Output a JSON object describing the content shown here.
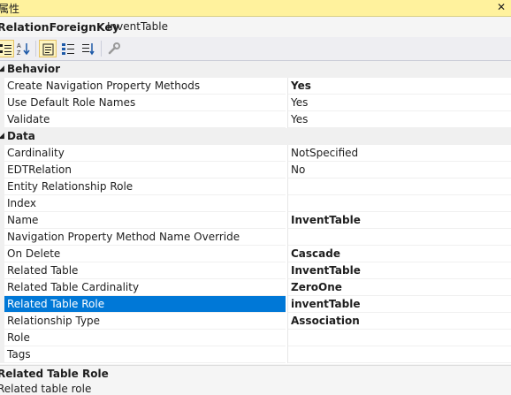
{
  "window": {
    "title": "属性",
    "close_glyph": "✕"
  },
  "object": {
    "name": "RelationForeignKey",
    "type": "InventTable"
  },
  "toolbar": {
    "buttons": [
      {
        "icon": "categorized-icon",
        "active": true
      },
      {
        "icon": "alphabetical-icon",
        "active": false
      },
      {
        "icon": "properties-icon",
        "active": true
      },
      {
        "icon": "events-icon",
        "active": false
      },
      {
        "icon": "sort-icon",
        "active": false
      },
      {
        "icon": "wrench-icon",
        "active": false
      }
    ]
  },
  "grid": {
    "categories": [
      {
        "label": "Behavior",
        "expander": "◢",
        "rows": [
          {
            "name": "Create Navigation Property Methods",
            "value": "Yes",
            "bold": true
          },
          {
            "name": "Use Default Role Names",
            "value": "Yes",
            "bold": false
          },
          {
            "name": "Validate",
            "value": "Yes",
            "bold": false
          }
        ]
      },
      {
        "label": "Data",
        "expander": "◢",
        "rows": [
          {
            "name": "Cardinality",
            "value": "NotSpecified",
            "bold": false
          },
          {
            "name": "EDTRelation",
            "value": "No",
            "bold": false
          },
          {
            "name": "Entity Relationship Role",
            "value": "",
            "bold": false
          },
          {
            "name": "Index",
            "value": "",
            "bold": false
          },
          {
            "name": "Name",
            "value": "InventTable",
            "bold": true
          },
          {
            "name": "Navigation Property Method Name Override",
            "value": "",
            "bold": false
          },
          {
            "name": "On Delete",
            "value": "Cascade",
            "bold": true
          },
          {
            "name": "Related Table",
            "value": "InventTable",
            "bold": true
          },
          {
            "name": "Related Table Cardinality",
            "value": "ZeroOne",
            "bold": true
          },
          {
            "name": "Related Table Role",
            "value": "inventTable",
            "bold": true,
            "selected": true
          },
          {
            "name": "Relationship Type",
            "value": "Association",
            "bold": true
          },
          {
            "name": "Role",
            "value": "",
            "bold": false
          },
          {
            "name": "Tags",
            "value": "",
            "bold": false
          }
        ]
      }
    ]
  },
  "description": {
    "title": "Related Table Role",
    "text": "Related table role"
  },
  "colors": {
    "title_bar": "#fff29d",
    "selection": "#0078d7",
    "category_bg": "#f0f0f0"
  }
}
